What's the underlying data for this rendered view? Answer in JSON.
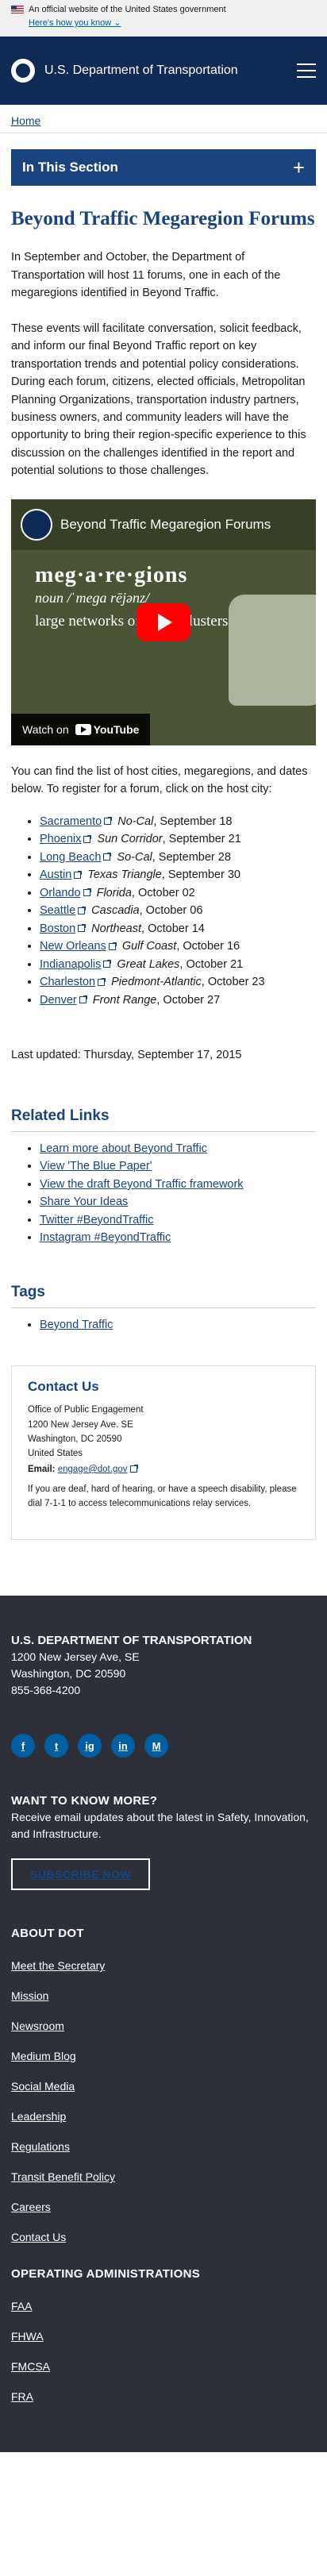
{
  "gov_banner": {
    "text": "An official website of the United States government",
    "how": "Here's how you know"
  },
  "header": {
    "title": "U.S. Department of Transportation"
  },
  "breadcrumb": {
    "home": "Home"
  },
  "section": {
    "label": "In This Section",
    "toggle": "+"
  },
  "page": {
    "title": "Beyond Traffic Megaregion Forums",
    "p1": "In September and October, the Department of Transportation will host 11 forums, one in each of the megaregions identified in Beyond Traffic.",
    "p2": "These events will facilitate conversation, solicit feedback, and inform our final Beyond Traffic report on key transportation trends and potential policy considerations. During each forum, citizens, elected officials, Metropolitan Planning Organizations, transportation industry partners, business owners, and community leaders will have the opportunity to bring their region-specific experience to this discussion on the challenges identified in the report and potential solutions to those challenges.",
    "p3": "You can find the list of host cities, megaregions, and dates below. To register for a forum, click on the host city:",
    "updated": "Last updated: Thursday, September 17, 2015"
  },
  "video": {
    "title": "Beyond Traffic Megaregion Forums",
    "word": "meg·a·re·gions",
    "pron": "noun /ˈmega rējənz/",
    "definition": "large networks of urban clusters",
    "watch_on": "Watch on",
    "youtube": "YouTube"
  },
  "forums": [
    {
      "city": "Sacramento",
      "region": "No-Cal",
      "date": "September 18"
    },
    {
      "city": "Phoenix",
      "region": "Sun Corridor",
      "date": "September 21"
    },
    {
      "city": "Long Beach",
      "region": "So-Cal",
      "date": "September 28"
    },
    {
      "city": "Austin",
      "region": "Texas Triangle",
      "date": "September 30"
    },
    {
      "city": "Orlando",
      "region": "Florida",
      "date": "October 02"
    },
    {
      "city": "Seattle",
      "region": "Cascadia",
      "date": "October 06"
    },
    {
      "city": "Boston",
      "region": "Northeast",
      "date": "October 14"
    },
    {
      "city": "New Orleans",
      "region": "Gulf Coast",
      "date": "October 16"
    },
    {
      "city": "Indianapolis",
      "region": "Great Lakes",
      "date": "October 21"
    },
    {
      "city": "Charleston",
      "region": "Piedmont-Atlantic",
      "date": "October 23"
    },
    {
      "city": "Denver",
      "region": "Front Range",
      "date": "October 27"
    }
  ],
  "related": {
    "heading": "Related Links",
    "items": [
      "Learn more about Beyond Traffic",
      "View 'The Blue Paper'",
      "View the draft Beyond Traffic framework",
      "Share Your Ideas",
      "Twitter #BeyondTraffic",
      "Instagram #BeyondTraffic"
    ]
  },
  "tags": {
    "heading": "Tags",
    "items": [
      "Beyond Traffic"
    ]
  },
  "contact": {
    "heading": "Contact Us",
    "office": "Office of Public Engagement",
    "street": "1200 New Jersey Ave. SE",
    "city": "Washington, DC 20590",
    "country": "United States",
    "email_label": "Email:",
    "email": "engage@dot.gov",
    "note": "If you are deaf, hard of hearing, or have a speech disability, please dial 7-1-1 to access telecommunications relay services."
  },
  "footer": {
    "name": "U.S. DEPARTMENT OF TRANSPORTATION",
    "street": "1200 New Jersey Ave, SE",
    "city": "Washington, DC 20590",
    "phone": "855-368-4200",
    "socials": [
      "f",
      "t",
      "ig",
      "in",
      "M"
    ],
    "know_heading": "WANT TO KNOW MORE?",
    "know_text": "Receive email updates about the latest in Safety, Innovation, and Infrastructure.",
    "subscribe": "SUBSCRIBE NOW",
    "about_heading": "ABOUT DOT",
    "about_items": [
      "Meet the Secretary",
      "Mission",
      "Newsroom",
      "Medium Blog",
      "Social Media",
      "Leadership",
      "Regulations",
      "Transit Benefit Policy",
      "Careers",
      "Contact Us"
    ],
    "opadmin_heading": "OPERATING ADMINISTRATIONS",
    "opadmin_items": [
      "FAA",
      "FHWA",
      "FMCSA",
      "FRA"
    ]
  }
}
